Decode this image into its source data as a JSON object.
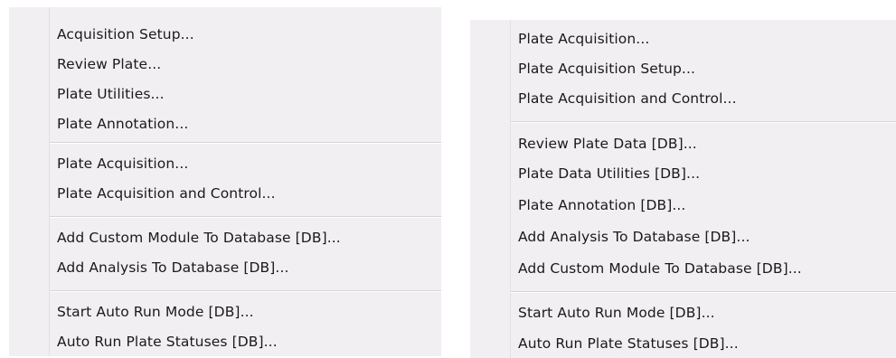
{
  "left_menu": {
    "groups": [
      [
        "Acquisition Setup...",
        "Review Plate...",
        "Plate Utilities...",
        "Plate Annotation..."
      ],
      [
        "Plate Acquisition...",
        "Plate Acquisition and Control..."
      ],
      [
        "Add Custom Module To Database [DB]...",
        "Add Analysis To Database [DB]..."
      ],
      [
        "Start Auto Run Mode [DB]...",
        "Auto Run Plate Statuses [DB]..."
      ]
    ]
  },
  "right_menu": {
    "groups": [
      [
        "Plate Acquisition...",
        "Plate Acquisition Setup...",
        "Plate Acquisition and Control..."
      ],
      [
        "Review Plate Data [DB]...",
        "Plate Data Utilities [DB]...",
        "Plate Annotation [DB]...",
        "Add Analysis To Database [DB]...",
        "Add Custom Module To Database [DB]..."
      ],
      [
        "Start Auto Run Mode [DB]...",
        "Auto Run Plate Statuses [DB]..."
      ]
    ]
  }
}
